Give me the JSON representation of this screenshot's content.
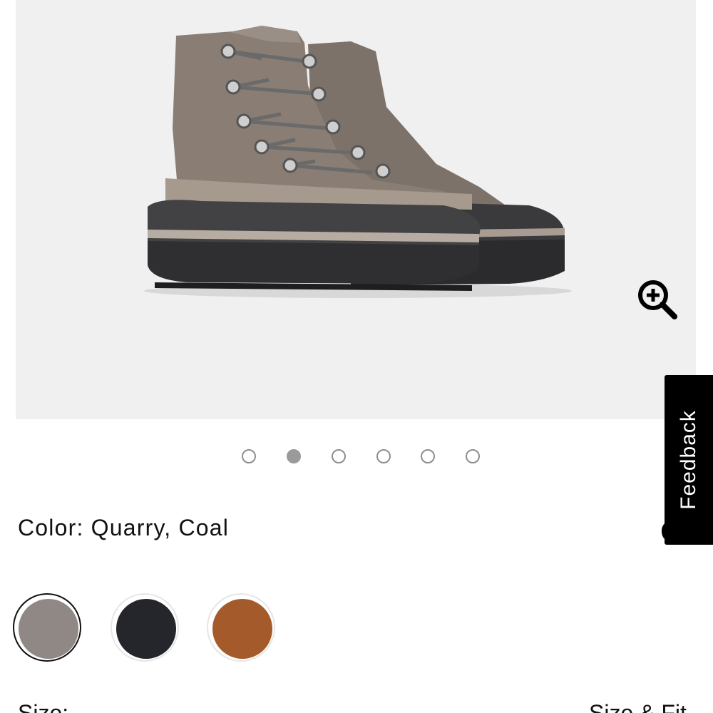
{
  "product": {
    "image_alt": "boot product image",
    "zoom_icon": "zoom-in-icon"
  },
  "carousel": {
    "dot_count": 6,
    "active_index": 1
  },
  "feedback": {
    "label": "Feedback"
  },
  "color": {
    "label": "Color:",
    "value": "Quarry, Coal",
    "swatches": [
      {
        "name": "Quarry",
        "hex": "#8f8884",
        "selected": true
      },
      {
        "name": "Black",
        "hex": "#25262b",
        "selected": false
      },
      {
        "name": "Brown",
        "hex": "#a45a2a",
        "selected": false
      }
    ]
  },
  "size": {
    "label": "Size:",
    "fit_link": "Size & Fit"
  },
  "colors": {
    "image_bg": "#f0f0f0",
    "accent": "#000000"
  }
}
